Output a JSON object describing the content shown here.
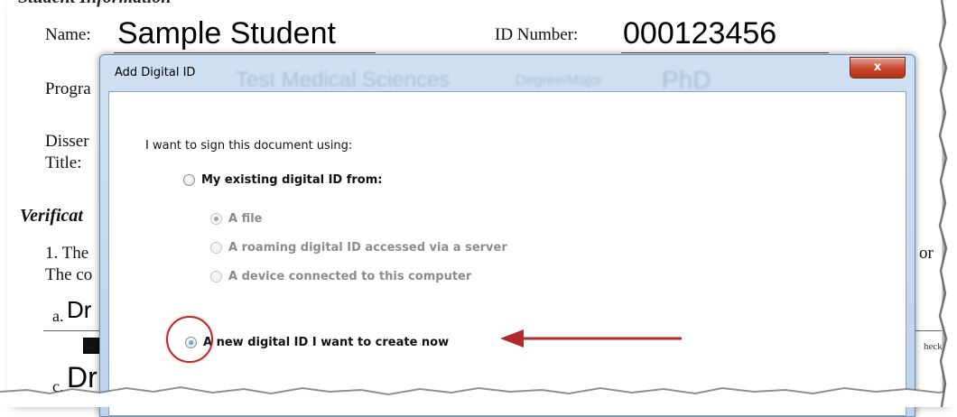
{
  "document": {
    "section_header": "Student Information",
    "name_label": "Name:",
    "name_value": "Sample Student",
    "id_label": "ID Number:",
    "id_value": "000123456",
    "program_label": "Progra",
    "dissertation_label": "Disser",
    "title_label": "Title:",
    "verification_label": "Verificat",
    "item1_line1": "1. The",
    "item1_line2": "The co",
    "item1_right": "or",
    "line_a_label": "a.",
    "line_a_value": "Dr",
    "line_c_label": "c.",
    "line_c_value": "Dr",
    "right_small": "heck"
  },
  "dialog": {
    "title": "Add Digital ID",
    "close_label": "x",
    "ghost_program": "Test Medical Sciences",
    "ghost_degree_label": "Degree/Major",
    "ghost_degree": "PhD",
    "prompt": "I want to sign this document using:",
    "options": {
      "existing": "My existing digital ID from:",
      "file": "A file",
      "roaming": "A roaming digital ID accessed via a server",
      "device": "A device connected to this computer",
      "new_id": "A new digital ID I want to create now"
    }
  },
  "colors": {
    "annotation": "#b22a2a",
    "dialog_frame": "#bdd3ec",
    "close_button": "#c9462c"
  }
}
